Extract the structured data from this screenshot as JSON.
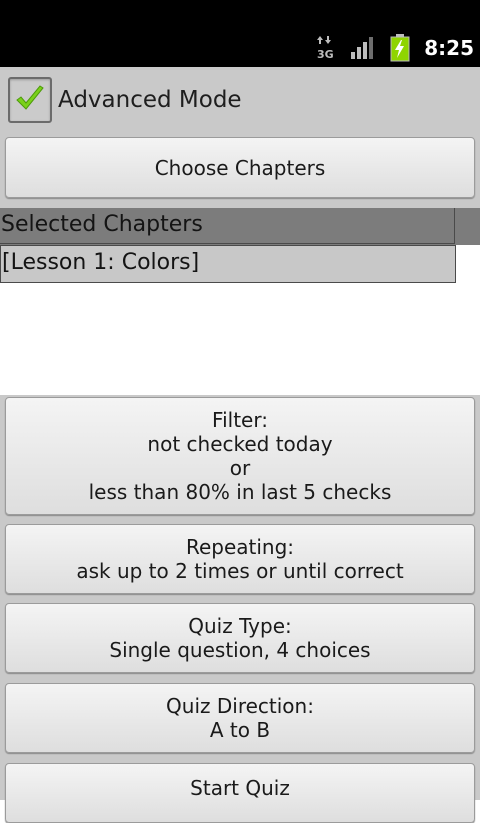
{
  "status_bar": {
    "network": "3G",
    "time": "8:25",
    "battery_color": "#8fd400"
  },
  "advanced_mode": {
    "label": "Advanced Mode",
    "checked": true
  },
  "choose_chapters": {
    "label": "Choose Chapters"
  },
  "selected_chapters": {
    "header": "Selected Chapters",
    "items": [
      "[Lesson 1: Colors]"
    ]
  },
  "filter": {
    "line1": "Filter:",
    "line2": "not checked today",
    "line3": "or",
    "line4": "less than 80% in last 5 checks"
  },
  "repeating": {
    "line1": "Repeating:",
    "line2": "ask up to 2 times or until correct"
  },
  "quiz_type": {
    "line1": "Quiz Type:",
    "line2": "Single question, 4 choices"
  },
  "quiz_direction": {
    "line1": "Quiz Direction:",
    "line2": "A to B"
  },
  "start_quiz": {
    "label": "Start Quiz"
  }
}
